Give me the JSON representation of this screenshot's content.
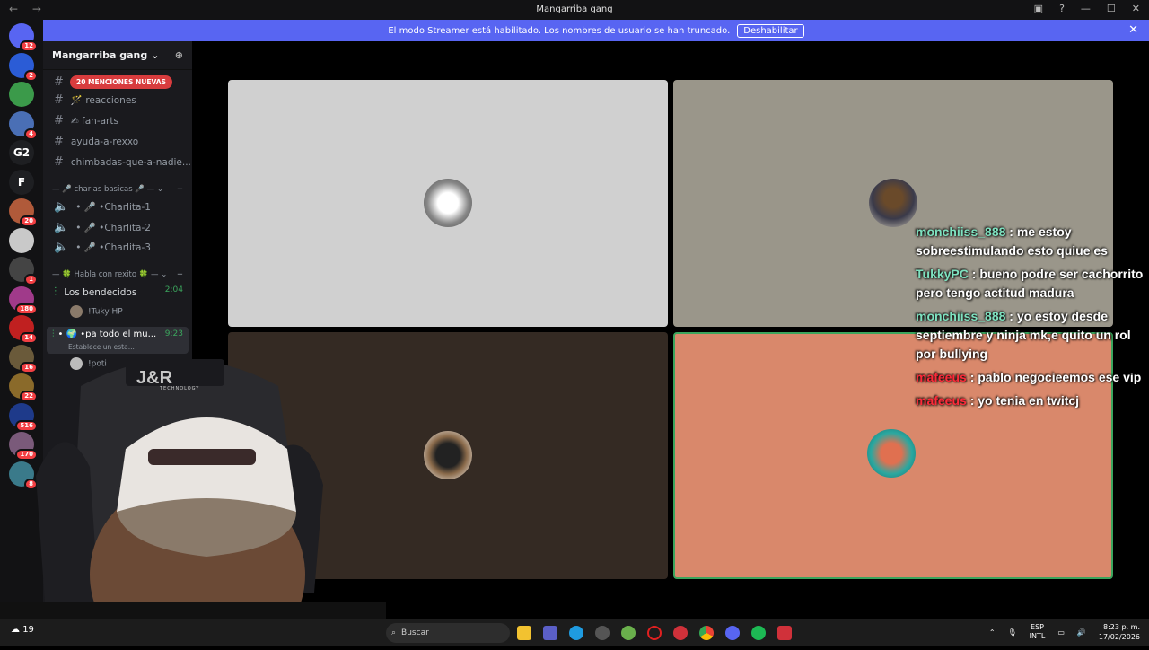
{
  "window": {
    "nav": "← →",
    "title": "Mangarriba gang",
    "controls": [
      "▣",
      "?",
      "—",
      "☐",
      "✕"
    ]
  },
  "banner": {
    "text": "El modo Streamer está habilitado. Los nombres de usuario se han truncado.",
    "button": "Deshabilitar",
    "close": "✕"
  },
  "servers": [
    {
      "label": "",
      "badge": "12",
      "color": "#5865f2",
      "icon": "discord-home-icon"
    },
    {
      "label": "",
      "badge": "2",
      "color": "#2b5cd6",
      "icon": "audio-wave-icon"
    },
    {
      "label": "",
      "badge": "",
      "color": "#3b9a4a",
      "icon": "server-icon"
    },
    {
      "label": "",
      "badge": "4",
      "color": "#4a6fb5",
      "icon": "server-icon"
    },
    {
      "label": "G2",
      "badge": "",
      "color": "#1e1f22",
      "icon": "text-icon"
    },
    {
      "label": "F",
      "badge": "",
      "color": "#1e1f22",
      "icon": "text-icon"
    },
    {
      "label": "",
      "badge": "20",
      "color": "#b05a3a",
      "icon": "server-icon"
    },
    {
      "label": "",
      "badge": "",
      "color": "#c9c9c9",
      "icon": "server-icon"
    },
    {
      "label": "",
      "badge": "1",
      "color": "#444",
      "icon": "server-icon"
    },
    {
      "label": "",
      "badge": "180",
      "color": "#a03a8a",
      "icon": "server-icon"
    },
    {
      "label": "",
      "badge": "14",
      "color": "#c02020",
      "icon": "server-icon"
    },
    {
      "label": "",
      "badge": "16",
      "color": "#6a5a3a",
      "icon": "server-icon"
    },
    {
      "label": "",
      "badge": "22",
      "color": "#8a6a2a",
      "icon": "server-icon"
    },
    {
      "label": "",
      "badge": "516",
      "color": "#1e3a8a",
      "icon": "server-icon"
    },
    {
      "label": "",
      "badge": "170",
      "color": "#7a5a7a",
      "icon": "server-icon"
    },
    {
      "label": "",
      "badge": "8",
      "color": "#3a7a8a",
      "icon": "server-icon"
    }
  ],
  "guild": {
    "name": "Mangarriba gang ⌄",
    "mentions_pill": "20 MENCIONES NUEVAS",
    "channels": [
      {
        "name": "🪄 reacciones"
      },
      {
        "name": "✍ fan-arts"
      },
      {
        "name": "ayuda-a-rexxo"
      },
      {
        "name": "chimbadas-que-a-nadie..."
      }
    ],
    "category1": "— 🎤 charlas basicas 🎤 —  ⌄",
    "voice_channels": [
      "• 🎤 •Charlita-1",
      "• 🎤 •Charlita-2",
      "• 🎤 •Charlita-3"
    ],
    "category2": "— 🍀 Habla con rexito 🍀 —  ⌄",
    "vc_bendecidos": {
      "name": "Los bendecidos",
      "time": "2:04",
      "member": "!Tuky HP"
    },
    "vc_active": {
      "name": "• 🌍 •pa todo el mu...",
      "time": "9:23",
      "status": "Establece un esta..."
    },
    "vc_members": [
      "!poti"
    ],
    "category_plus": "+"
  },
  "chat": [
    {
      "user": "monchiiss_888",
      "text": " : me estoy sobreestimulando esto quiue es",
      "red": false
    },
    {
      "user": "TukkyPC",
      "text": " : bueno podre ser cachorrito pero tengo actitud madura",
      "red": false
    },
    {
      "user": "monchiiss_888",
      "text": " : yo estoy desde septiembre y ninja mk,e quito un rol por bullying",
      "red": false
    },
    {
      "user": "mafeeus",
      "text": " : pablo negocieemos ese vip",
      "red": true
    },
    {
      "user": "mafeeus",
      "text": " : yo tenia en twitcj",
      "red": true
    }
  ],
  "overlay": {
    "logo": "J&R",
    "logo_sub": "TECHNOLOGY"
  },
  "taskbar": {
    "search_placeholder": "Buscar",
    "lang": "ESP",
    "layout": "INTL",
    "time": "8:23 p. m.",
    "date": "17/02/2026",
    "weather": "19"
  },
  "colors": {
    "accent": "#5865f2",
    "tile1": "#d0d0d0",
    "tile2": "#9a968a",
    "tile3": "#342a23",
    "tile4": "#d9886b",
    "speaking": "#3ba55d"
  }
}
